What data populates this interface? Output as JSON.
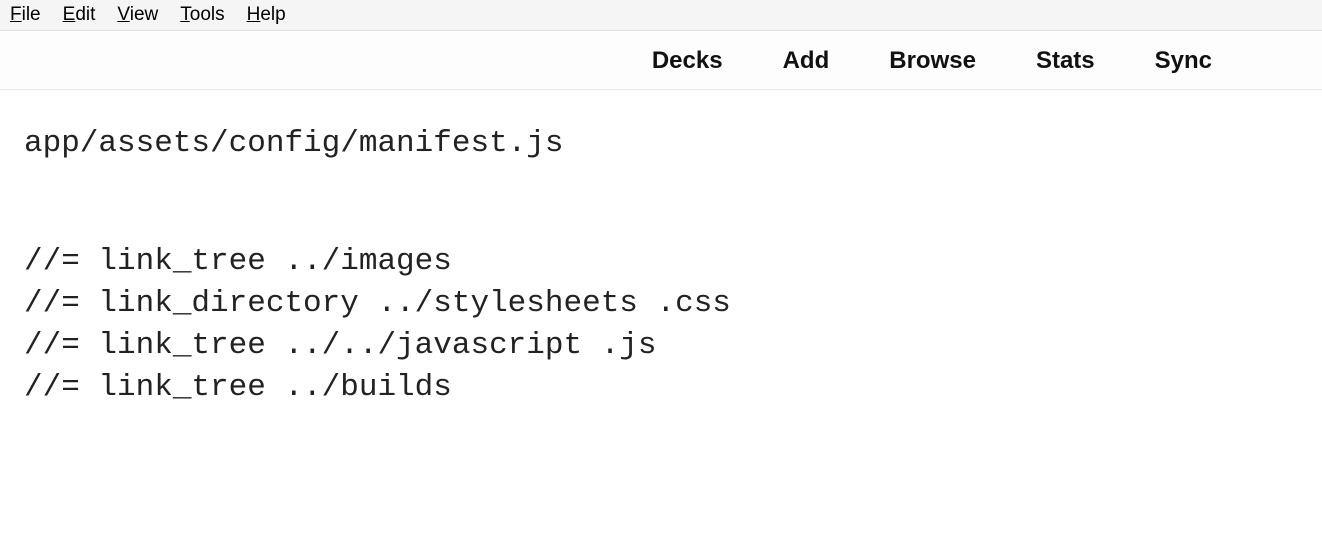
{
  "menubar": {
    "file": "File",
    "edit": "Edit",
    "view": "View",
    "tools": "Tools",
    "help": "Help"
  },
  "toolbar": {
    "decks": "Decks",
    "add": "Add",
    "browse": "Browse",
    "stats": "Stats",
    "sync": "Sync"
  },
  "card": {
    "filepath": "app/assets/config/manifest.js",
    "code": "//= link_tree ../images\n//= link_directory ../stylesheets .css\n//= link_tree ../../javascript .js\n//= link_tree ../builds"
  }
}
